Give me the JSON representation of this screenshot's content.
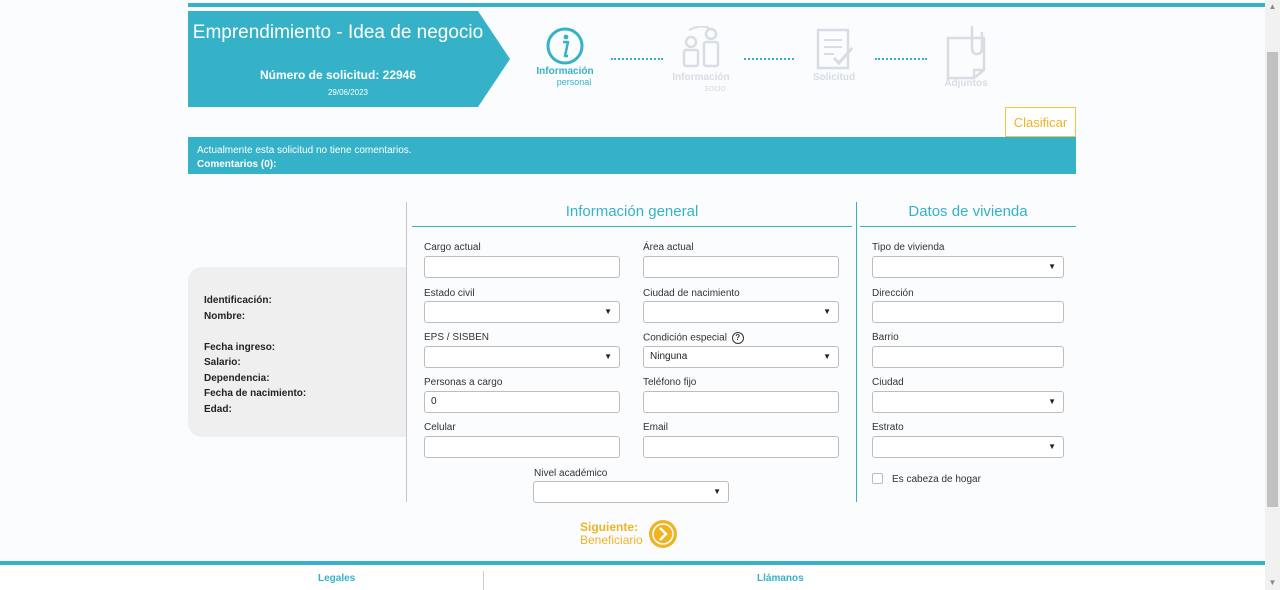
{
  "header": {
    "title": "Emprendimiento - Idea de negocio",
    "request_label": "Número de solicitud: 22946",
    "date": "29/06/2023"
  },
  "steps": [
    {
      "label": "Información",
      "sublabel": "personal",
      "icon": "info-icon",
      "active": true
    },
    {
      "label": "Información",
      "sublabel": "socio",
      "icon": "partners-icon",
      "active": false
    },
    {
      "label": "Solicitud",
      "sublabel": "",
      "icon": "document-check-icon",
      "active": false
    },
    {
      "label": "Adjuntos",
      "sublabel": "",
      "icon": "attachment-icon",
      "active": false
    }
  ],
  "classify_button": "Clasificar",
  "comments": {
    "status": "Actualmente esta solicitud no tiene comentarios.",
    "label": "Comentarios (0):"
  },
  "profile": {
    "identificacion": "Identificación:",
    "nombre": "Nombre:",
    "fecha_ingreso": "Fecha ingreso:",
    "salario": "Salario:",
    "dependencia": "Dependencia:",
    "fecha_nacimiento": "Fecha de nacimiento:",
    "edad": "Edad:"
  },
  "general": {
    "title": "Información general",
    "cargo_actual": {
      "label": "Cargo actual",
      "value": ""
    },
    "area_actual": {
      "label": "Área actual",
      "value": ""
    },
    "estado_civil": {
      "label": "Estado civil",
      "value": ""
    },
    "ciudad_nacimiento": {
      "label": "Ciudad de nacimiento",
      "value": ""
    },
    "eps": {
      "label": "EPS / SISBEN",
      "value": ""
    },
    "condicion_especial": {
      "label": "Condición especial",
      "value": "Ninguna"
    },
    "personas_cargo": {
      "label": "Personas a cargo",
      "value": "0"
    },
    "telefono_fijo": {
      "label": "Teléfono fijo",
      "value": ""
    },
    "celular": {
      "label": "Celular",
      "value": ""
    },
    "email": {
      "label": "Email",
      "value": ""
    },
    "nivel_academico": {
      "label": "Nivel académico",
      "value": ""
    }
  },
  "vivienda": {
    "title": "Datos de vivienda",
    "tipo_vivienda": {
      "label": "Tipo de vivienda",
      "value": ""
    },
    "direccion": {
      "label": "Dirección",
      "value": ""
    },
    "barrio": {
      "label": "Barrio",
      "value": ""
    },
    "ciudad": {
      "label": "Ciudad",
      "value": ""
    },
    "estrato": {
      "label": "Estrato",
      "value": ""
    },
    "cabeza_hogar": {
      "label": "Es cabeza de hogar",
      "checked": false
    }
  },
  "next": {
    "label": "Siguiente:",
    "target": "Beneficiario"
  },
  "footer": {
    "legales": "Legales",
    "llamanos": "Llámanos"
  },
  "colors": {
    "primary": "#36b2c8",
    "accent": "#f0b324"
  }
}
